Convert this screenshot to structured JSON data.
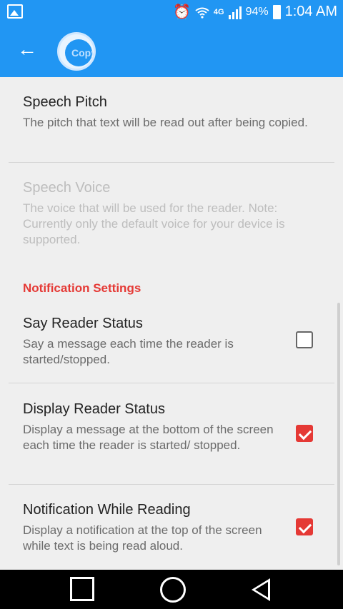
{
  "status_bar": {
    "network": "4G",
    "battery": "94%",
    "time": "1:04 AM"
  },
  "app_bar": {
    "logo_text": "Copy"
  },
  "settings": {
    "speech_pitch": {
      "title": "Speech Pitch",
      "summary": "The pitch that text will be read out after being copied."
    },
    "speech_voice": {
      "title": "Speech Voice",
      "summary": "The voice that will be used for the reader. Note: Currently only the default voice for your device is supported."
    },
    "notification_section": "Notification Settings",
    "say_reader_status": {
      "title": "Say Reader Status",
      "summary": "Say a message each time the reader is started/stopped.",
      "checked": false
    },
    "display_reader_status": {
      "title": "Display Reader Status",
      "summary": "Display a message at the bottom of the screen each time the reader is started/ stopped.",
      "checked": true
    },
    "notification_while_reading": {
      "title": "Notification While Reading",
      "summary": "Display a notification at the top of the screen while text is being read aloud.",
      "checked": true
    }
  },
  "colors": {
    "primary": "#2196f3",
    "accent": "#e53935",
    "background": "#efefef"
  }
}
